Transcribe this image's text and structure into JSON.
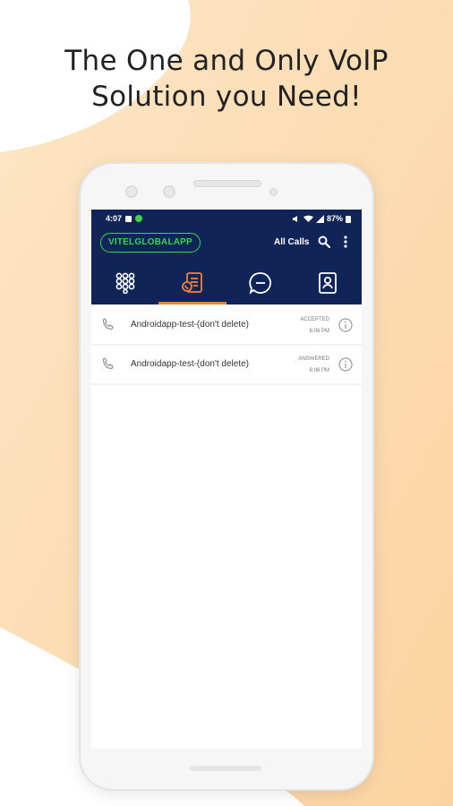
{
  "headline": {
    "line1": "The One and Only VoIP",
    "line2": "Solution you Need!"
  },
  "status_bar": {
    "time": "4:07",
    "battery": "87%"
  },
  "header": {
    "brand": "VITELGLOBALAPP",
    "filter_label": "All Calls",
    "icons": [
      "search-icon",
      "more-vertical-icon"
    ]
  },
  "tabs": [
    {
      "icon": "dialpad-icon",
      "active": false
    },
    {
      "icon": "call-log-icon",
      "active": true
    },
    {
      "icon": "chat-icon",
      "active": false
    },
    {
      "icon": "contacts-icon",
      "active": false
    }
  ],
  "calls": [
    {
      "name": "Androidapp-test-(don't delete)",
      "status": "ACCEPTED",
      "time": "6:06 PM",
      "icon": "phone-icon"
    },
    {
      "name": "Androidapp-test-(don't delete)",
      "status": "ANSWERED",
      "time": "6:06 PM",
      "icon": "phone-icon"
    }
  ],
  "colors": {
    "header_bg": "#102457",
    "brand_green": "#3bd44a",
    "active_tab": "#f0813b",
    "background_swoosh": "#fbd9ac"
  }
}
